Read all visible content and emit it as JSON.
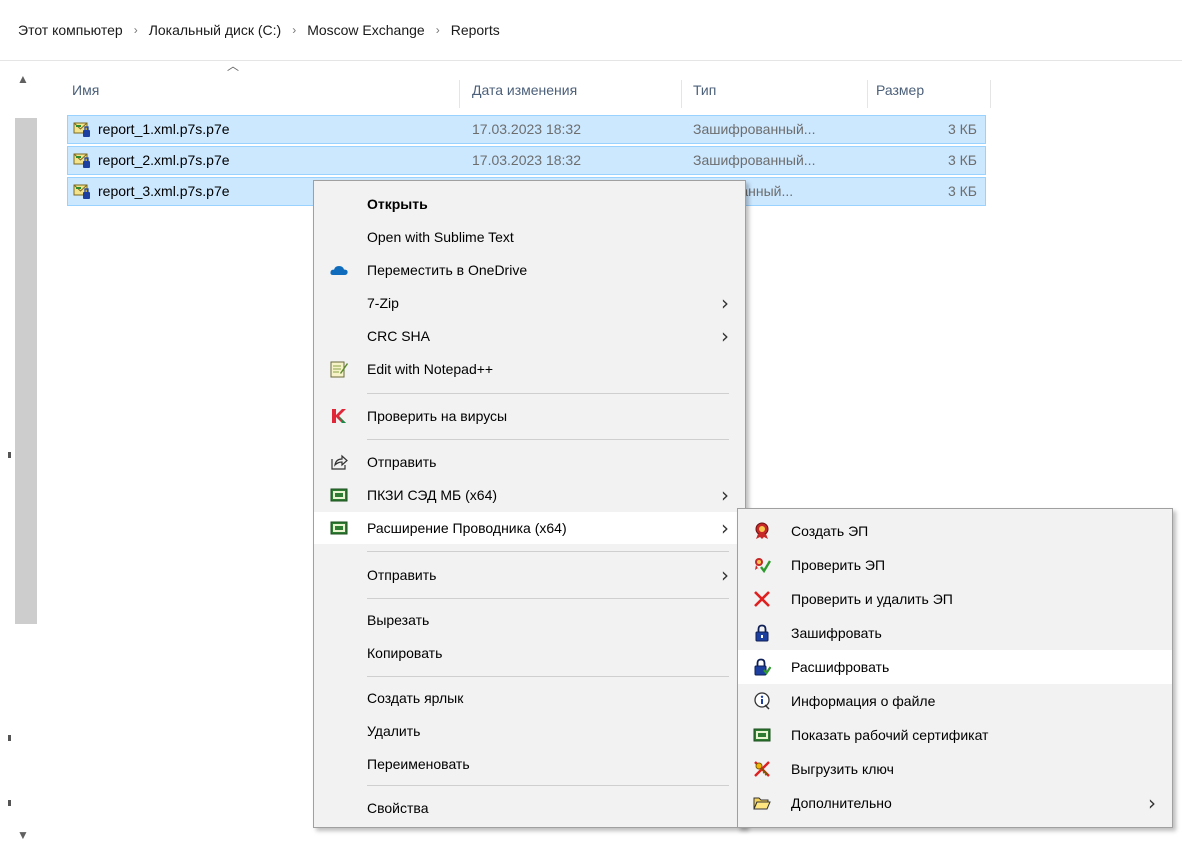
{
  "breadcrumb": {
    "items": [
      "Этот компьютер",
      "Локальный диск (C:)",
      "Moscow Exchange",
      "Reports"
    ],
    "separator": "›"
  },
  "columns": {
    "name": "Имя",
    "modified": "Дата изменения",
    "type": "Тип",
    "size": "Размер"
  },
  "files": [
    {
      "name": "report_1.xml.p7s.p7e",
      "modified": "17.03.2023 18:32",
      "type": "Зашифрованный...",
      "size": "3 КБ"
    },
    {
      "name": "report_2.xml.p7s.p7e",
      "modified": "17.03.2023 18:32",
      "type": "Зашифрованный...",
      "size": "3 КБ"
    },
    {
      "name": "report_3.xml.p7s.p7e",
      "modified": "",
      "type": "фрованный...",
      "size": "3 КБ"
    }
  ],
  "context_menu": {
    "open": "Открыть",
    "sublime": "Open with Sublime Text",
    "onedrive": "Переместить в OneDrive",
    "zip": "7-Zip",
    "crc": "CRC SHA",
    "notepad": "Edit with Notepad++",
    "scan": "Проверить на вирусы",
    "share": "Отправить",
    "pkzi": "ПКЗИ СЭД МБ (x64)",
    "explorer_ext": "Расширение Проводника (x64)",
    "send_to": "Отправить",
    "cut": "Вырезать",
    "copy": "Копировать",
    "shortcut": "Создать ярлык",
    "delete": "Удалить",
    "rename": "Переименовать",
    "properties": "Свойства"
  },
  "submenu": {
    "create_sig": "Создать ЭП",
    "verify_sig": "Проверить ЭП",
    "verify_delete_sig": "Проверить и удалить ЭП",
    "encrypt": "Зашифровать",
    "decrypt": "Расшифровать",
    "file_info": "Информация о файле",
    "show_cert": "Показать рабочий сертификат",
    "export_key": "Выгрузить ключ",
    "more": "Дополнительно"
  },
  "colors": {
    "selection_fill": "#cce8ff",
    "selection_border": "#99d1ff",
    "header_text": "#4c607a",
    "menu_bg": "#f2f2f2",
    "onedrive_blue": "#0f6cbd"
  }
}
